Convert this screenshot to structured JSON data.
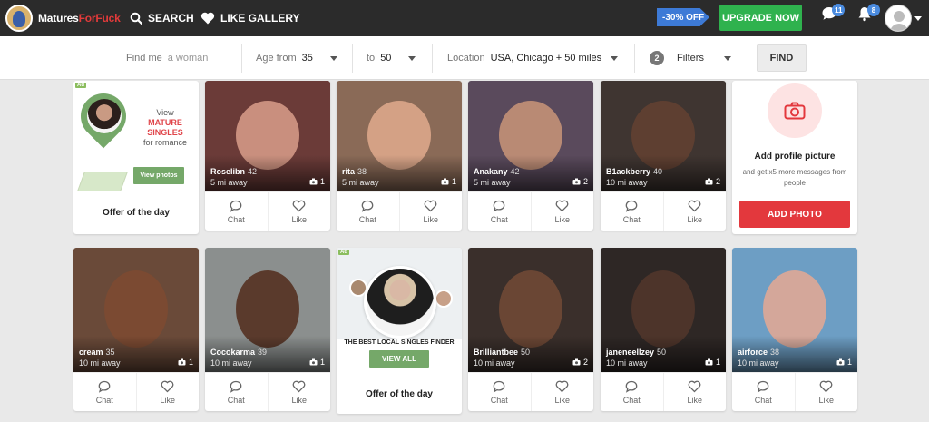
{
  "header": {
    "logo_part1": "Matures",
    "logo_part2": "ForFuck",
    "search_label": "SEARCH",
    "gallery_label": "LIKE GALLERY",
    "promo": "-30% OFF",
    "upgrade_label": "UPGRADE NOW",
    "messages_count": "11",
    "notifications_count": "8"
  },
  "search": {
    "find_me_label": "Find me",
    "find_me_value": "a woman",
    "age_from_label": "Age from",
    "age_from_value": "35",
    "age_to_label": "to",
    "age_to_value": "50",
    "location_label": "Location",
    "location_value": "USA, Chicago + 50 miles",
    "filters_count": "2",
    "filters_label": "Filters",
    "find_label": "FIND"
  },
  "ad1": {
    "tag": "Ad",
    "line1": "View",
    "line2": "MATURE",
    "line3": "SINGLES",
    "line4": "for romance",
    "button": "View photos",
    "offer": "Offer of the day"
  },
  "ad2": {
    "tag": "Ad",
    "title": "THE BEST LOCAL SINGLES FINDER",
    "button": "VIEW ALL",
    "offer": "Offer of the day"
  },
  "add_picture": {
    "title": "Add profile picture",
    "subtitle": "and get x5 more messages from people",
    "button": "ADD PHOTO"
  },
  "actions": {
    "chat": "Chat",
    "like": "Like"
  },
  "profiles": [
    {
      "name": "Roselibn",
      "age": "42",
      "distance": "5 mi away",
      "photos": "1",
      "bg": "#6b3b38",
      "face": "#c98f7e"
    },
    {
      "name": "rita",
      "age": "38",
      "distance": "5 mi away",
      "photos": "1",
      "bg": "#8a6a57",
      "face": "#d4a185"
    },
    {
      "name": "Anakany",
      "age": "42",
      "distance": "5 mi away",
      "photos": "2",
      "bg": "#5a4a5c",
      "face": "#b98a74"
    },
    {
      "name": "B1ackberry",
      "age": "40",
      "distance": "10 mi away",
      "photos": "2",
      "bg": "#3f3531",
      "face": "#5e3f31"
    },
    {
      "name": "cream",
      "age": "35",
      "distance": "10 mi away",
      "photos": "1",
      "bg": "#6a4a39",
      "face": "#7b4a32"
    },
    {
      "name": "Cocokarma",
      "age": "39",
      "distance": "10 mi away",
      "photos": "1",
      "bg": "#8b8f8e",
      "face": "#5a3a2c"
    },
    {
      "name": "Brilliantbee",
      "age": "50",
      "distance": "10 mi away",
      "photos": "2",
      "bg": "#3a2f2b",
      "face": "#6a4634"
    },
    {
      "name": "janeneellzey",
      "age": "50",
      "distance": "10 mi away",
      "photos": "1",
      "bg": "#2e2725",
      "face": "#4d342a"
    },
    {
      "name": "airforce",
      "age": "38",
      "distance": "10 mi away",
      "photos": "1",
      "bg": "#6d9ec4",
      "face": "#d4a79a"
    }
  ]
}
